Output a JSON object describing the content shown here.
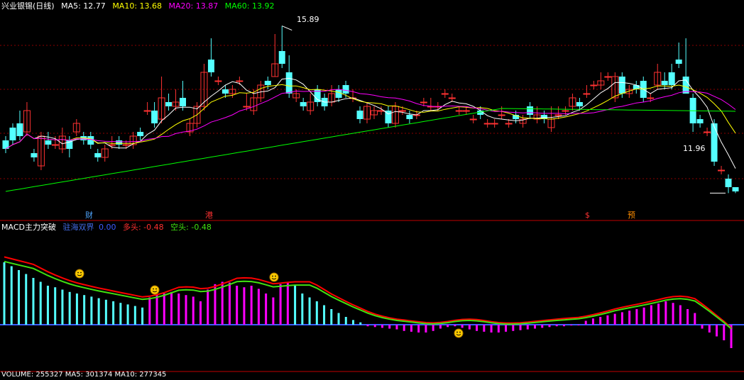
{
  "colors": {
    "background": "#000000",
    "up_candle": "#ff3232",
    "down_candle": "#54ffff",
    "ma5": "#ffffff",
    "ma10": "#ffff00",
    "ma20": "#ff00ff",
    "ma60": "#00ff00",
    "macd_fast": "#ff0000",
    "macd_slow": "#40e010",
    "grid": "#8b0000",
    "divider": "#c00000"
  },
  "main_panel": {
    "stock_title": "兴业银锡(日线)",
    "ma5_label": "MA5: 12.77",
    "ma10_label": "MA10: 13.68",
    "ma20_label": "MA20: 13.87",
    "ma60_label": "MA60: 13.92",
    "high_marker": "15.89",
    "low_marker": "11.96",
    "events": [
      {
        "label": "财",
        "color": "#4fa6ff"
      },
      {
        "label": "港",
        "color": "#ff3232"
      },
      {
        "label": "$",
        "color": "#ff3232"
      },
      {
        "label": "预",
        "color": "#ff8c00"
      }
    ]
  },
  "macd_panel": {
    "title": "MACD主力突破",
    "label1": "驻海双界",
    "value1": "0.00",
    "label2": "多头: -0.48",
    "label3": "空头: -0.48",
    "signal_icon": "smiley-icon"
  },
  "volume_panel": {
    "title_partial": "VOLUME: 255327  MA5: 301374  MA10: 277345"
  },
  "chart_data": {
    "type": "candlestick",
    "price_range": [
      11.5,
      16.2
    ],
    "candles": [
      [
        13.2,
        13.0,
        13.3,
        12.9
      ],
      [
        13.5,
        13.2,
        13.6,
        13.1
      ],
      [
        13.6,
        13.3,
        13.9,
        13.2
      ],
      [
        13.4,
        13.9,
        14.1,
        13.3
      ],
      [
        12.9,
        12.8,
        13.0,
        12.7
      ],
      [
        12.6,
        13.3,
        13.4,
        12.5
      ],
      [
        13.2,
        13.1,
        13.4,
        13.0
      ],
      [
        13.1,
        13.1,
        13.3,
        13.0
      ],
      [
        13.0,
        13.3,
        13.5,
        12.9
      ],
      [
        13.2,
        13.0,
        13.3,
        12.8
      ],
      [
        13.4,
        13.6,
        13.7,
        13.3
      ],
      [
        13.3,
        13.2,
        13.4,
        13.1
      ],
      [
        13.3,
        13.1,
        13.4,
        13.0
      ],
      [
        12.9,
        12.8,
        13.0,
        12.7
      ],
      [
        12.8,
        13.0,
        13.1,
        12.7
      ],
      [
        13.1,
        13.1,
        13.3,
        13.0
      ],
      [
        13.2,
        13.1,
        13.3,
        13.0
      ],
      [
        13.1,
        13.1,
        13.2,
        13.0
      ],
      [
        13.1,
        13.3,
        13.4,
        13.0
      ],
      [
        13.4,
        13.3,
        13.5,
        13.2
      ],
      [
        13.9,
        13.9,
        14.1,
        13.8
      ],
      [
        13.9,
        13.6,
        14.1,
        13.5
      ],
      [
        13.7,
        14.2,
        14.7,
        13.6
      ],
      [
        14.1,
        14.0,
        14.3,
        13.9
      ],
      [
        14.0,
        14.1,
        14.4,
        13.9
      ],
      [
        14.2,
        14.0,
        14.6,
        13.9
      ],
      [
        13.4,
        13.6,
        13.7,
        13.3
      ],
      [
        13.6,
        14.0,
        14.1,
        13.5
      ],
      [
        14.0,
        14.8,
        15.0,
        13.9
      ],
      [
        15.1,
        14.8,
        15.6,
        14.7
      ],
      [
        14.6,
        14.6,
        14.7,
        14.5
      ],
      [
        14.4,
        14.3,
        14.5,
        14.2
      ],
      [
        14.3,
        14.4,
        14.5,
        14.2
      ],
      [
        14.6,
        14.6,
        14.7,
        14.5
      ],
      [
        14.0,
        14.0,
        14.3,
        13.9
      ],
      [
        13.9,
        14.2,
        14.4,
        13.8
      ],
      [
        14.2,
        14.5,
        14.6,
        14.1
      ],
      [
        14.6,
        14.5,
        14.7,
        14.4
      ],
      [
        14.7,
        15.0,
        15.7,
        14.7
      ],
      [
        15.3,
        15.0,
        15.89,
        14.9
      ],
      [
        14.8,
        14.3,
        15.2,
        14.2
      ],
      [
        14.2,
        14.3,
        14.4,
        14.1
      ],
      [
        14.1,
        14.0,
        14.2,
        13.9
      ],
      [
        13.9,
        14.1,
        14.3,
        13.8
      ],
      [
        14.4,
        14.1,
        14.5,
        14.0
      ],
      [
        14.2,
        14.0,
        14.3,
        13.9
      ],
      [
        14.1,
        14.3,
        14.5,
        14.0
      ],
      [
        14.4,
        14.2,
        14.5,
        14.1
      ],
      [
        14.5,
        14.3,
        14.6,
        14.2
      ],
      [
        14.2,
        14.2,
        14.4,
        14.1
      ],
      [
        13.9,
        13.7,
        14.0,
        13.6
      ],
      [
        13.7,
        14.0,
        14.1,
        13.6
      ],
      [
        13.8,
        13.9,
        14.0,
        13.7
      ],
      [
        13.9,
        13.9,
        14.0,
        13.8
      ],
      [
        13.9,
        13.6,
        14.0,
        13.5
      ],
      [
        13.6,
        14.0,
        14.1,
        13.5
      ],
      [
        13.9,
        13.9,
        14.0,
        13.8
      ],
      [
        13.8,
        13.7,
        13.9,
        13.6
      ],
      [
        13.8,
        13.8,
        13.9,
        13.7
      ],
      [
        14.1,
        14.1,
        14.2,
        14.0
      ],
      [
        14.0,
        14.0,
        14.2,
        13.9
      ],
      [
        14.0,
        14.0,
        14.1,
        13.9
      ],
      [
        14.3,
        14.3,
        14.4,
        14.2
      ],
      [
        14.2,
        14.2,
        14.3,
        14.1
      ],
      [
        13.9,
        13.9,
        14.0,
        13.8
      ],
      [
        13.9,
        13.9,
        14.0,
        13.8
      ],
      [
        13.7,
        13.7,
        13.8,
        13.6
      ],
      [
        13.9,
        13.8,
        14.0,
        13.7
      ],
      [
        13.6,
        13.6,
        13.7,
        13.5
      ],
      [
        13.6,
        13.6,
        13.7,
        13.5
      ],
      [
        13.8,
        13.8,
        14.0,
        13.7
      ],
      [
        13.6,
        13.6,
        13.7,
        13.5
      ],
      [
        13.8,
        13.7,
        13.9,
        13.6
      ],
      [
        13.6,
        13.7,
        13.8,
        13.5
      ],
      [
        14.0,
        13.8,
        14.1,
        13.7
      ],
      [
        13.7,
        13.8,
        14.0,
        13.6
      ],
      [
        13.8,
        13.7,
        13.9,
        13.6
      ],
      [
        13.5,
        13.7,
        14.0,
        13.4
      ],
      [
        13.8,
        13.8,
        14.0,
        13.7
      ],
      [
        13.9,
        13.9,
        14.0,
        13.8
      ],
      [
        14.0,
        14.2,
        14.3,
        13.9
      ],
      [
        14.1,
        14.0,
        14.2,
        13.9
      ],
      [
        14.3,
        14.3,
        14.5,
        14.2
      ],
      [
        14.5,
        14.5,
        14.6,
        14.4
      ],
      [
        14.5,
        14.6,
        14.8,
        14.4
      ],
      [
        14.7,
        14.7,
        14.8,
        14.6
      ],
      [
        14.2,
        14.7,
        14.8,
        14.1
      ],
      [
        14.7,
        14.3,
        14.8,
        14.2
      ],
      [
        14.3,
        14.4,
        14.5,
        14.2
      ],
      [
        14.5,
        14.4,
        14.6,
        14.3
      ],
      [
        14.6,
        14.2,
        14.7,
        14.1
      ],
      [
        14.2,
        14.2,
        14.3,
        14.1
      ],
      [
        14.5,
        14.8,
        15.0,
        14.4
      ],
      [
        14.6,
        14.5,
        14.8,
        14.4
      ],
      [
        14.8,
        14.5,
        15.0,
        14.4
      ],
      [
        15.1,
        15.0,
        15.5,
        14.9
      ],
      [
        14.7,
        14.3,
        15.6,
        14.3
      ],
      [
        14.2,
        13.6,
        14.3,
        13.4
      ],
      [
        13.7,
        13.6,
        13.8,
        13.5
      ],
      [
        13.4,
        13.4,
        13.5,
        13.3
      ],
      [
        13.6,
        12.7,
        13.7,
        12.6
      ],
      [
        12.5,
        12.5,
        12.6,
        12.4
      ],
      [
        12.3,
        12.1,
        12.4,
        11.96
      ],
      [
        12.1,
        12.0,
        12.1,
        11.96
      ]
    ],
    "macd_bars": [
      0.8,
      0.75,
      0.7,
      0.65,
      0.6,
      0.55,
      0.5,
      0.48,
      0.45,
      0.42,
      0.4,
      0.38,
      0.36,
      0.34,
      0.32,
      0.3,
      0.28,
      0.26,
      0.24,
      0.22,
      0.35,
      0.38,
      0.4,
      0.42,
      0.4,
      0.38,
      0.36,
      0.3,
      0.45,
      0.52,
      0.55,
      0.54,
      0.5,
      0.48,
      0.5,
      0.46,
      0.4,
      0.35,
      0.52,
      0.55,
      0.5,
      0.4,
      0.35,
      0.3,
      0.25,
      0.2,
      0.15,
      0.1,
      0.06,
      0.03,
      -0.02,
      -0.03,
      -0.04,
      -0.05,
      -0.06,
      -0.08,
      -0.09,
      -0.1,
      -0.1,
      -0.08,
      -0.05,
      -0.03,
      -0.02,
      -0.04,
      -0.06,
      -0.08,
      -0.09,
      -0.1,
      -0.1,
      -0.09,
      -0.08,
      -0.07,
      -0.06,
      -0.05,
      -0.04,
      -0.03,
      -0.02,
      -0.02,
      -0.01,
      0.0,
      0.05,
      0.08,
      0.1,
      0.12,
      0.14,
      0.16,
      0.18,
      0.2,
      0.22,
      0.25,
      0.27,
      0.3,
      0.28,
      0.25,
      0.2,
      0.15,
      -0.05,
      -0.1,
      -0.15,
      -0.2,
      -0.3
    ]
  }
}
